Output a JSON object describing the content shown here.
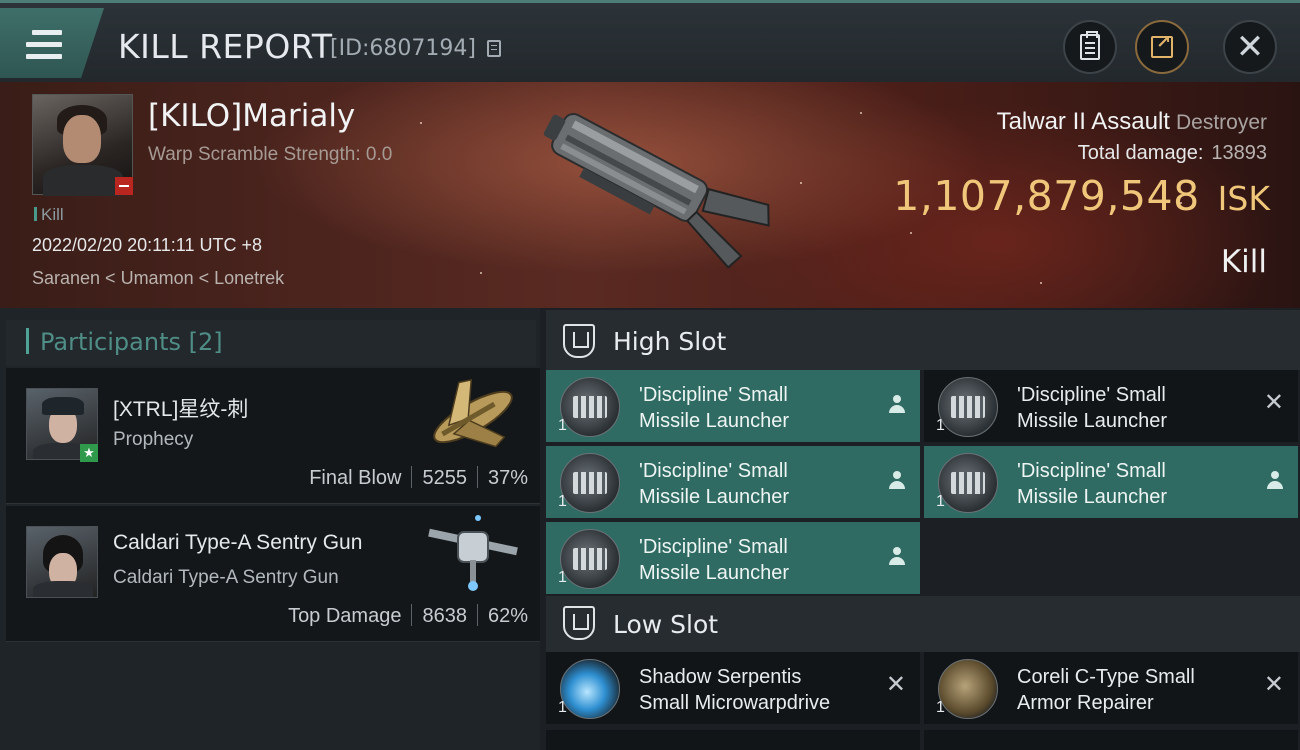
{
  "header": {
    "title": "KILL REPORT",
    "report_id": "[ID:6807194]"
  },
  "victim": {
    "name": "[KILO]Marialy",
    "warp_scramble": "Warp Scramble Strength: 0.0",
    "tag": "Kill",
    "time": "2022/02/20 20:11:11 UTC +8",
    "location": "Saranen < Umamon < Lonetrek",
    "ship_name": "Talwar II Assault",
    "ship_class": "Destroyer",
    "total_damage_label": "Total damage:",
    "total_damage": "13893",
    "isk_value": "1,107,879,548",
    "isk_unit": "ISK",
    "result": "Kill"
  },
  "participants": {
    "title": "Participants [2]",
    "items": [
      {
        "name": "[XTRL]星纹-刺",
        "ship": "Prophecy",
        "stat_label": "Final Blow",
        "damage": "5255",
        "percent": "37%"
      },
      {
        "name": "Caldari Type-A Sentry Gun",
        "ship": "Caldari Type-A Sentry Gun",
        "stat_label": "Top Damage",
        "damage": "8638",
        "percent": "62%"
      }
    ]
  },
  "slots": {
    "high_title": "High Slot",
    "low_title": "Low Slot",
    "high": [
      {
        "line1": "'Discipline' Small",
        "line2": "Missile Launcher",
        "qty": "1",
        "state": "dropped"
      },
      {
        "line1": "'Discipline' Small",
        "line2": "Missile Launcher",
        "qty": "1",
        "state": "destroyed"
      },
      {
        "line1": "'Discipline' Small",
        "line2": "Missile Launcher",
        "qty": "1",
        "state": "dropped"
      },
      {
        "line1": "'Discipline' Small",
        "line2": "Missile Launcher",
        "qty": "1",
        "state": "dropped"
      },
      {
        "line1": "'Discipline' Small",
        "line2": "Missile Launcher",
        "qty": "1",
        "state": "dropped"
      }
    ],
    "low": [
      {
        "line1": "Shadow Serpentis",
        "line2": "Small Microwarpdrive",
        "qty": "1",
        "state": "destroyed"
      },
      {
        "line1": "Coreli C-Type Small",
        "line2": "Armor Repairer",
        "qty": "1",
        "state": "destroyed"
      }
    ]
  },
  "colors": {
    "accent_teal": "#2f6b63",
    "isk_gold": "#f0c77a",
    "loss_red": "#b9251f"
  }
}
